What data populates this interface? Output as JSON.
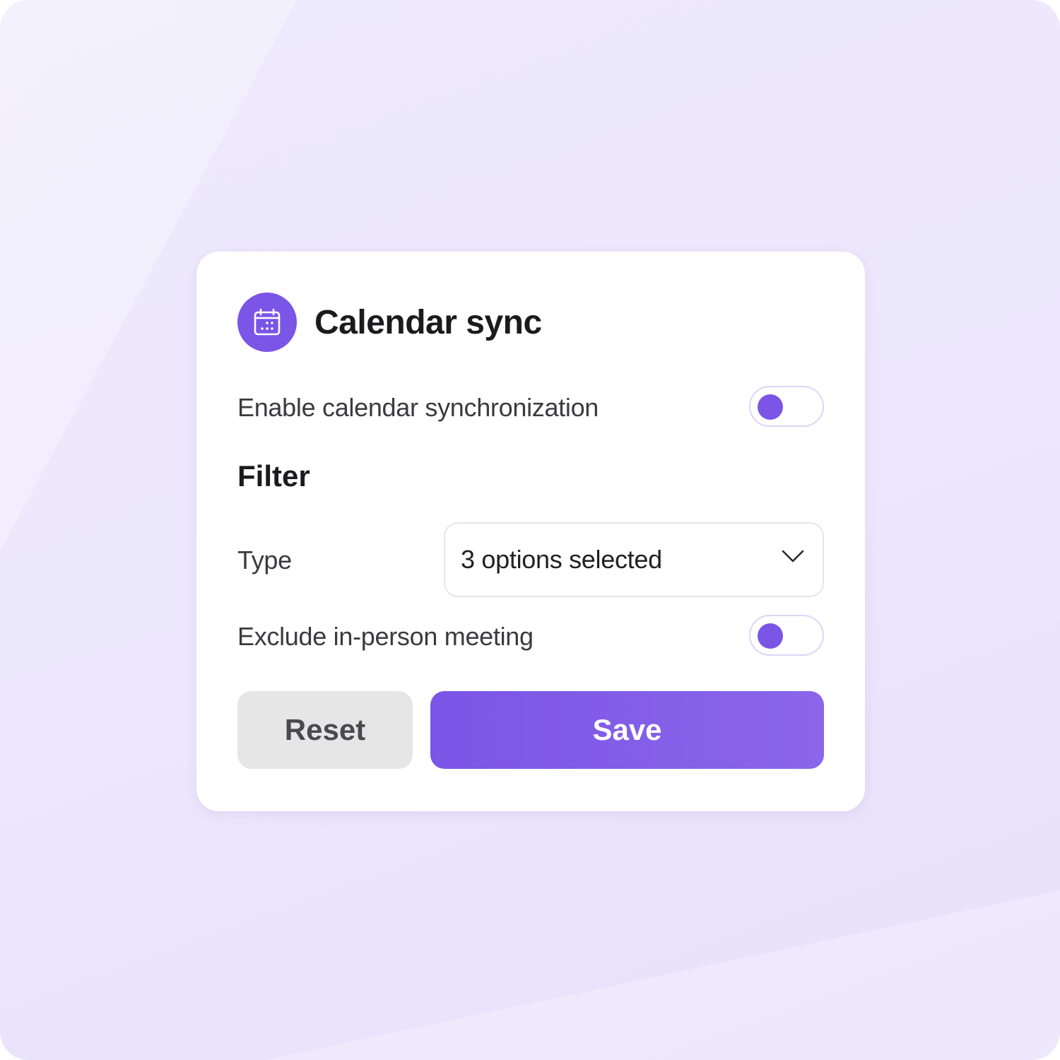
{
  "colors": {
    "accent": "#7b55e6",
    "background": "#ece7fc",
    "card": "#ffffff",
    "reset_bg": "#e6e6e6",
    "toggle_border": "#ddd5f7"
  },
  "card": {
    "icon": "calendar-icon",
    "title": "Calendar sync",
    "enable_sync": {
      "label": "Enable calendar synchronization",
      "state": "off"
    },
    "filter": {
      "title": "Filter",
      "type": {
        "label": "Type",
        "value": "3 options selected",
        "icon": "chevron-down-icon"
      },
      "exclude_in_person": {
        "label": "Exclude in-person meeting",
        "state": "off"
      }
    },
    "buttons": {
      "reset": "Reset",
      "save": "Save"
    }
  }
}
